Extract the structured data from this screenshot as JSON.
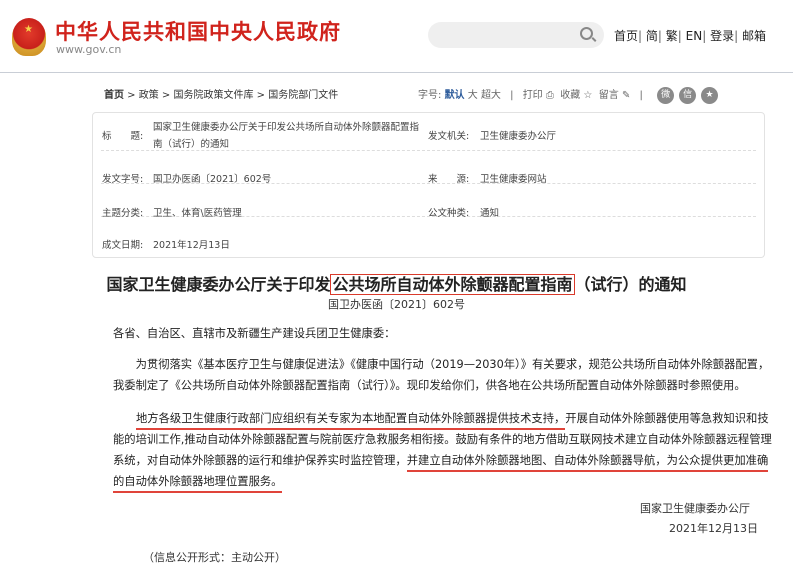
{
  "header": {
    "site_title": "中华人民共和国中央人民政府",
    "site_url": "www.gov.cn",
    "search_placeholder": "",
    "nav": [
      "首页",
      "简",
      "繁",
      "EN",
      "登录",
      "邮箱"
    ]
  },
  "breadcrumb": [
    "首页",
    "政策",
    "国务院政策文件库",
    "国务院部门文件"
  ],
  "tools": {
    "font_label": "字号:",
    "font_default": "默认",
    "font_large": "大",
    "font_xlarge": "超大",
    "print": "打印",
    "favorite": "收藏",
    "comment": "留言"
  },
  "info": {
    "title_label": "标　　题:",
    "title": "国家卫生健康委办公厅关于印发公共场所自动体外除颤器配置指南（试行）的通知",
    "issuer_label": "发文机关:",
    "issuer": "卫生健康委办公厅",
    "docno_label": "发文字号:",
    "docno": "国卫办医函〔2021〕602号",
    "source_label": "来　　源:",
    "source": "卫生健康委网站",
    "topic_label": "主题分类:",
    "topic": "卫生、体育\\医药管理",
    "type_label": "公文种类:",
    "type": "通知",
    "date_label": "成文日期:",
    "date": "2021年12月13日"
  },
  "doc": {
    "title_pre": "国家卫生健康委办公厅关于印发",
    "title_hl": "公共场所自动体外除颤器配置指南",
    "title_post": "（试行）的通知",
    "number": "国卫办医函〔2021〕602号",
    "salutation": "各省、自治区、直辖市及新疆生产建设兵团卫生健康委：",
    "p1_l1": "　　为贯彻落实《基本医疗卫生与健康促进法》《健康中国行动（2019—2030年）》有关要求，规范公共场所自动体外除颤器配置，",
    "p1_l2": "我委制定了《公共场所自动体外除颤器配置指南（试行）》。现印发给你们，供各地在公共场所配置自动体外除颤器时参照使用。",
    "p2_l1a": "地方各级卫生健康行政部门应组织有关专家为本地配置自动体外除颤器提供技术支持，",
    "p2_l1b": "开展自动体外除颤器使用等急救知识和技",
    "p2_l2": "能的培训工作,推动自动体外除颤器配置与院前医疗急救服务相衔接。鼓励有条件的地方借助互联网技术建立自动体外除颤器远程管理",
    "p2_l3a": "系统，对自动体外除颤器的运行和维护保养实时监控管理，",
    "p2_l3b": "并建立自动体外除颤器地图、自动体外除颤器导航，为公众提供更加准确",
    "p2_l4": "的自动体外除颤器地理位置服务。",
    "signer": "国家卫生健康委办公厅",
    "sign_date": "2021年12月13日",
    "footer": "（信息公开形式：主动公开）"
  }
}
